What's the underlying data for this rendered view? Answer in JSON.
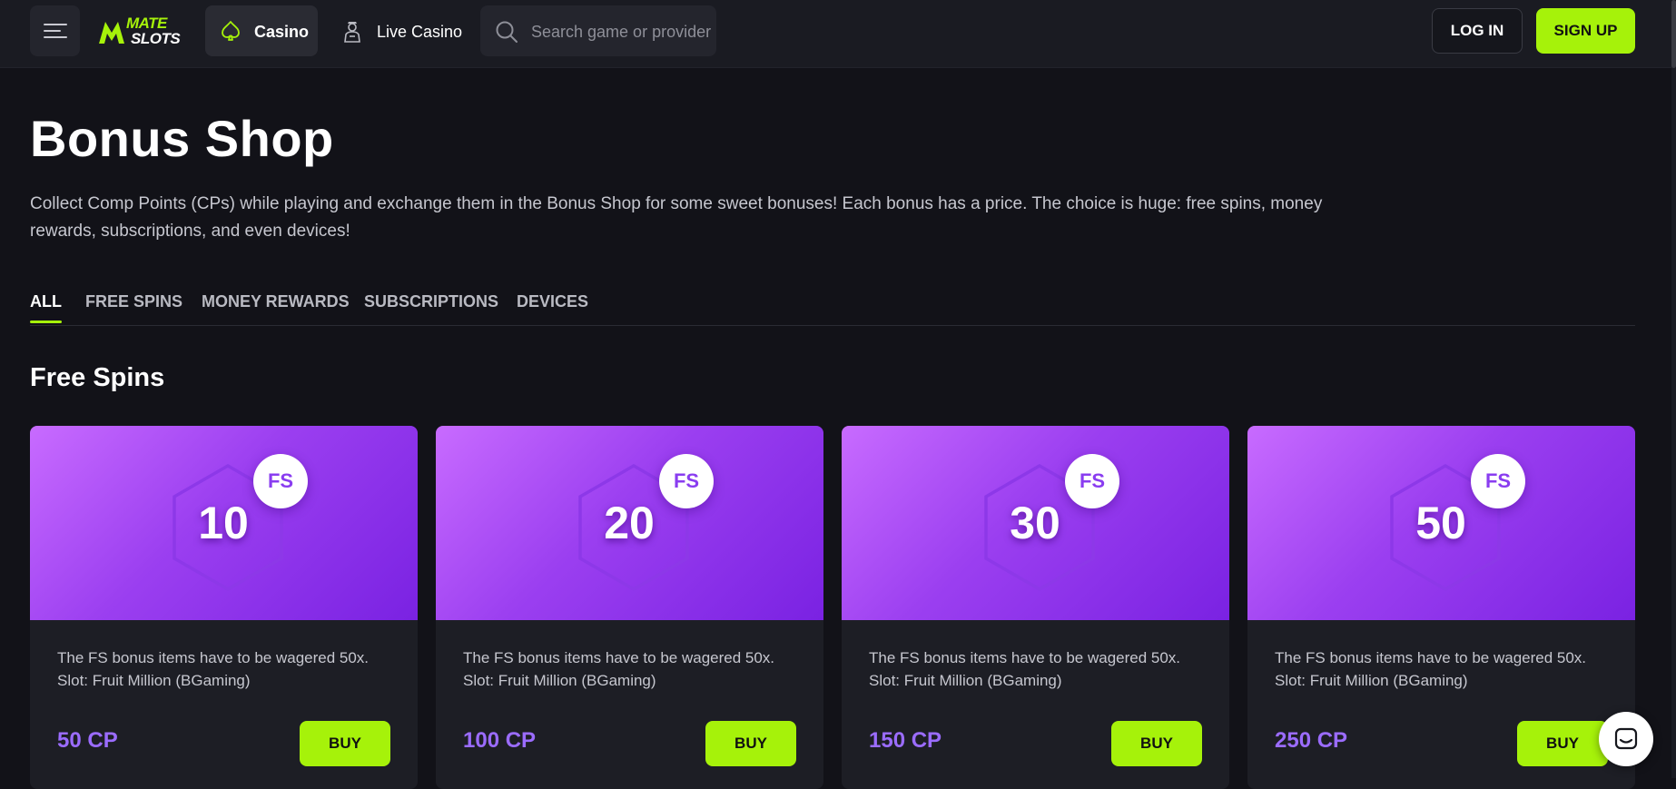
{
  "header": {
    "logo": {
      "line1": "MATE",
      "line2": "SLOTS"
    },
    "nav": [
      {
        "label": "Casino",
        "icon": "spade-icon",
        "active": true
      },
      {
        "label": "Live Casino",
        "icon": "dealer-icon",
        "active": false
      }
    ],
    "search": {
      "placeholder": "Search game or provider",
      "value": ""
    },
    "login_label": "LOG IN",
    "signup_label": "SIGN UP"
  },
  "page": {
    "title": "Bonus Shop",
    "intro": "Collect Comp Points (CPs) while playing and exchange them in the Bonus Shop for some sweet bonuses! Each bonus has a price. The choice is huge: free spins, money rewards, subscriptions, and even devices!"
  },
  "tabs": [
    {
      "label": "ALL",
      "active": true
    },
    {
      "label": "FREE SPINS",
      "active": false
    },
    {
      "label": "MONEY REWARDS",
      "active": false
    },
    {
      "label": "SUBSCRIPTIONS",
      "active": false
    },
    {
      "label": "DEVICES",
      "active": false
    }
  ],
  "section": {
    "title": "Free Spins"
  },
  "cards": [
    {
      "amount": "10",
      "badge": "FS",
      "desc": "The FS bonus items have to be wagered 50x. Slot: Fruit Million (BGaming)",
      "price": "50 CP",
      "buy_label": "BUY"
    },
    {
      "amount": "20",
      "badge": "FS",
      "desc": "The FS bonus items have to be wagered 50x. Slot: Fruit Million (BGaming)",
      "price": "100 CP",
      "buy_label": "BUY"
    },
    {
      "amount": "30",
      "badge": "FS",
      "desc": "The FS bonus items have to be wagered 50x. Slot: Fruit Million (BGaming)",
      "price": "150 CP",
      "buy_label": "BUY"
    },
    {
      "amount": "50",
      "badge": "FS",
      "desc": "The FS bonus items have to be wagered 50x. Slot: Fruit Million (BGaming)",
      "price": "250 CP",
      "buy_label": "BUY"
    }
  ],
  "colors": {
    "accent": "#a6f20a",
    "background": "#121218",
    "card_gradient_start": "#c86bff",
    "card_gradient_end": "#7a22e2",
    "price": "#9b6cff"
  },
  "icons": {
    "menu": "hamburger-icon",
    "search": "search-icon",
    "chat": "chat-icon"
  }
}
